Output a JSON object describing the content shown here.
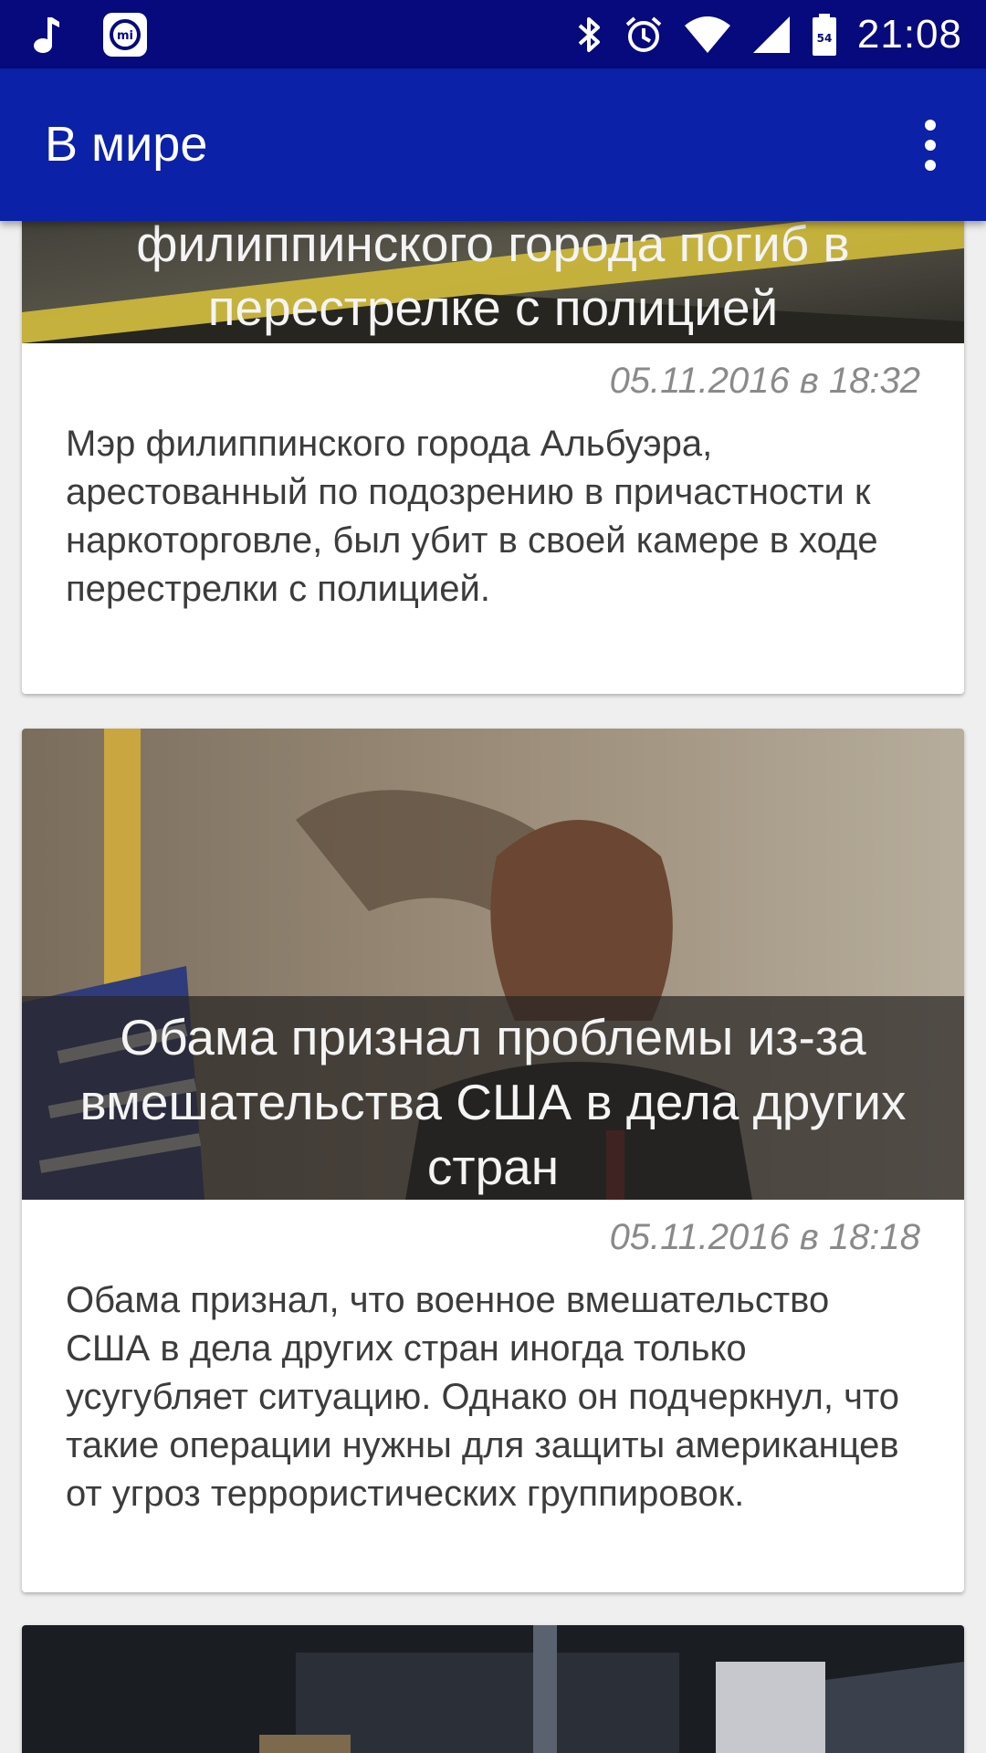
{
  "status_bar": {
    "time": "21:08",
    "battery_level": "54",
    "icons": [
      "music-note-icon",
      "mi-app-icon",
      "bluetooth-icon",
      "alarm-icon",
      "wifi-icon",
      "signal-icon",
      "battery-icon"
    ]
  },
  "app_bar": {
    "title": "В мире",
    "menu_icon": "more-vert-icon"
  },
  "colors": {
    "status_bar": "#060a7c",
    "app_bar": "#0a21a8",
    "background": "#efefef",
    "date_text": "#8a8a8a",
    "body_text": "#3c3c3c"
  },
  "articles": [
    {
      "headline": "филиппинского города погиб в перестрелке с полицией",
      "date": "05.11.2016 в 18:32",
      "summary": "Мэр филиппинского города Альбуэра, арестованный по подозрению в причастности к наркоторговле, был убит в своей камере в ходе перестрелки с полицией."
    },
    {
      "headline": "Обама признал проблемы из-за вмешательства США в дела других стран",
      "date": "05.11.2016 в 18:18",
      "summary": "Обама признал, что военное вмешательство США в дела других стран иногда только усугубляет ситуацию. Однако он подчеркнул, что такие операции нужны для защиты американцев от угроз террористических группировок."
    }
  ]
}
